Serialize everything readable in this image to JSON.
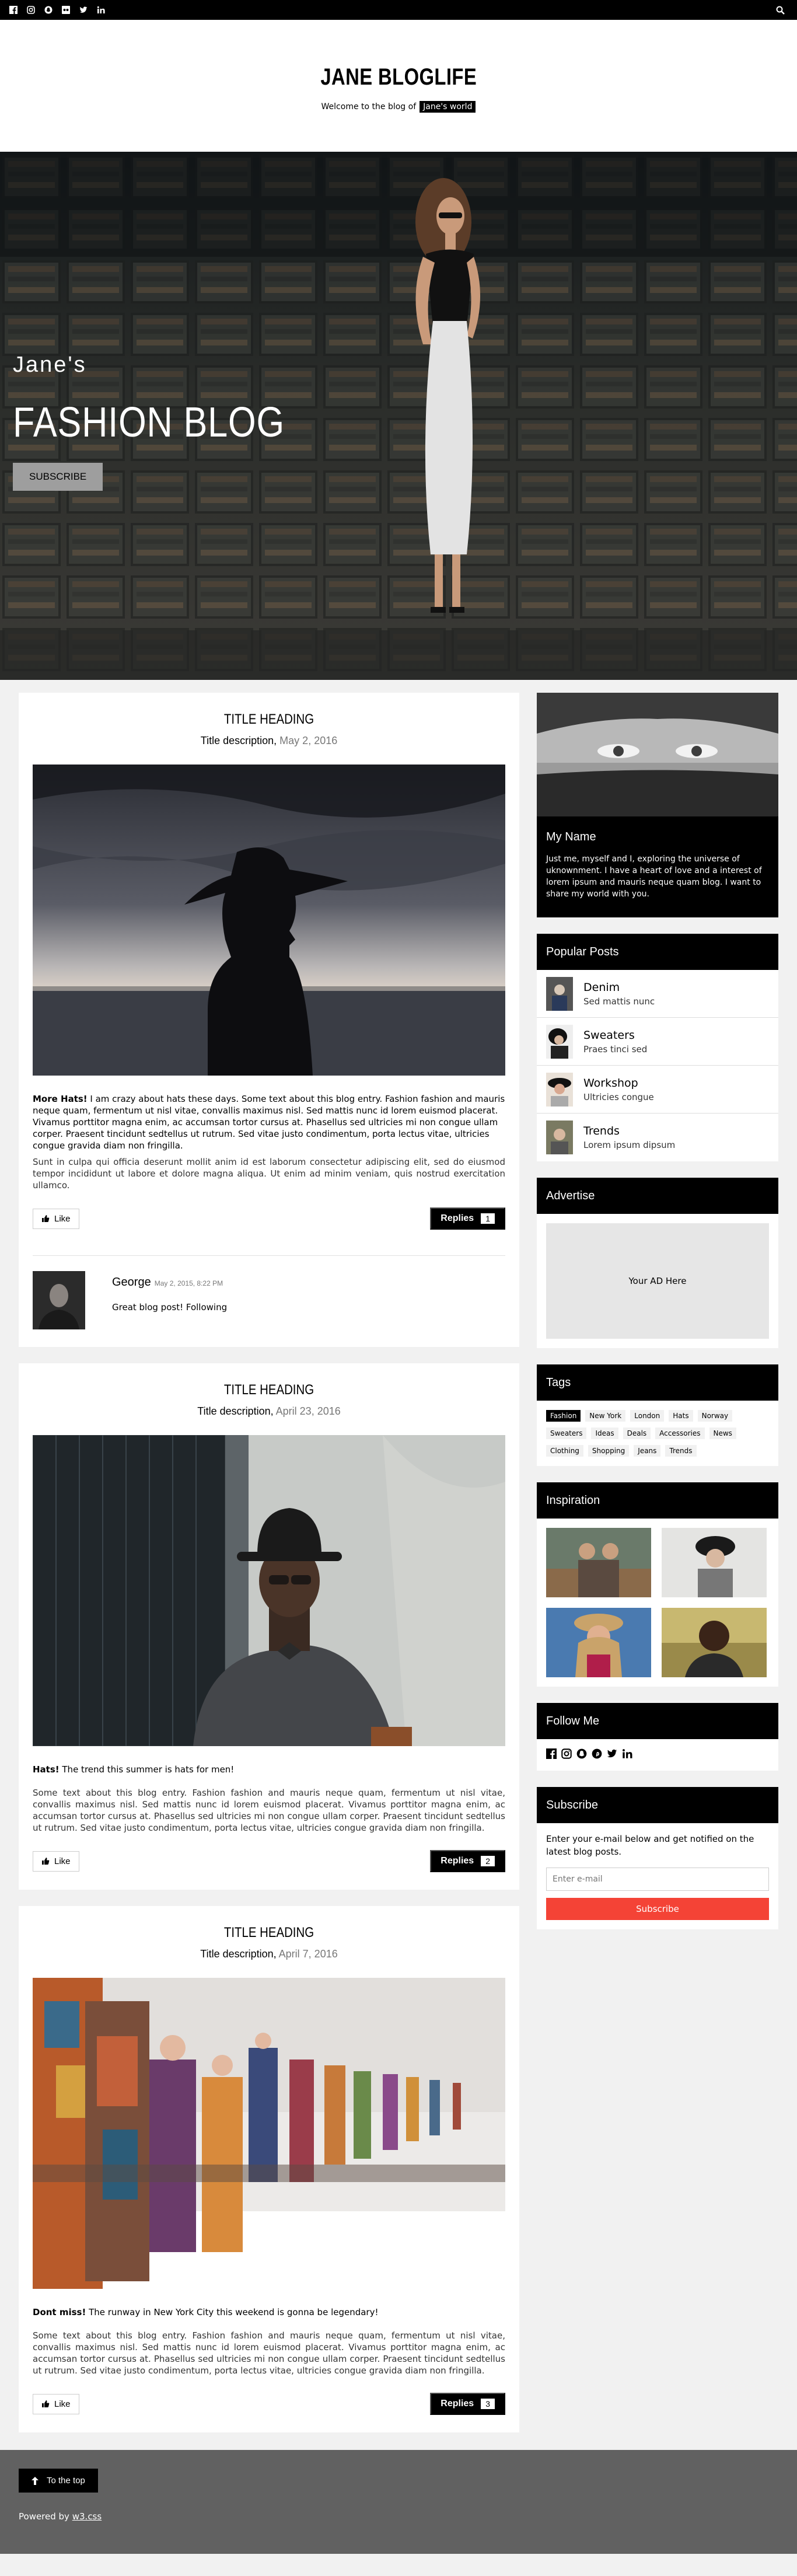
{
  "topbar": {
    "icons": [
      "facebook-icon",
      "instagram-icon",
      "snapchat-icon",
      "flickr-icon",
      "twitter-icon",
      "linkedin-icon"
    ],
    "search_icon": "search-icon"
  },
  "header": {
    "title": "JANE BLOGLIFE",
    "tagline": "Welcome to the blog of",
    "tagline_tag": "Jane's world"
  },
  "hero": {
    "small": "Jane's",
    "big": "FASHION BLOG",
    "button": "SUBSCRIBE"
  },
  "posts": [
    {
      "title": "TITLE HEADING",
      "subtitle": "Title description,",
      "date": "May 2, 2016",
      "lead_bold": "More Hats!",
      "lead": " I am crazy about hats these days. Some text about this blog entry. Fashion fashion and mauris neque quam, fermentum ut nisl vitae, convallis maximus nisl. Sed mattis nunc id lorem euismod placerat. Vivamus porttitor magna enim, ac accumsan tortor cursus at. Phasellus sed ultricies mi non congue ullam corper. Praesent tincidunt sedtellus ut rutrum. Sed vitae justo condimentum, porta lectus vitae, ultricies congue gravida diam non fringilla.",
      "body": "Sunt in culpa qui officia deserunt mollit anim id est laborum consectetur adipiscing elit, sed do eiusmod tempor incididunt ut labore et dolore magna aliqua. Ut enim ad minim veniam, quis nostrud exercitation ullamco.",
      "like": "Like",
      "replies": "Replies",
      "reply_count": "1",
      "comment": {
        "name": "George",
        "date": "May 2, 2015, 8:22 PM",
        "text": "Great blog post! Following"
      }
    },
    {
      "title": "TITLE HEADING",
      "subtitle": "Title description,",
      "date": "April 23, 2016",
      "lead_bold": "Hats!",
      "lead": " The trend this summer is hats for men!",
      "body": "Some text about this blog entry. Fashion fashion and mauris neque quam, fermentum ut nisl vitae, convallis maximus nisl. Sed mattis nunc id lorem euismod placerat. Vivamus porttitor magna enim, ac accumsan tortor cursus at. Phasellus sed ultricies mi non congue ullam corper. Praesent tincidunt sedtellus ut rutrum. Sed vitae justo condimentum, porta lectus vitae, ultricies congue gravida diam non fringilla.",
      "like": "Like",
      "replies": "Replies",
      "reply_count": "2"
    },
    {
      "title": "TITLE HEADING",
      "subtitle": "Title description,",
      "date": "April 7, 2016",
      "lead_bold": "Dont miss!",
      "lead": " The runway in New York City this weekend is gonna be legendary!",
      "body": "Some text about this blog entry. Fashion fashion and mauris neque quam, fermentum ut nisl vitae, convallis maximus nisl. Sed mattis nunc id lorem euismod placerat. Vivamus porttitor magna enim, ac accumsan tortor cursus at. Phasellus sed ultricies mi non congue ullam corper. Praesent tincidunt sedtellus ut rutrum. Sed vitae justo condimentum, porta lectus vitae, ultricies congue gravida diam non fringilla.",
      "like": "Like",
      "replies": "Replies",
      "reply_count": "3"
    }
  ],
  "sidebar": {
    "profile": {
      "name": "My Name",
      "text": "Just me, myself and I, exploring the universe of uknownment. I have a heart of love and a interest of lorem ipsum and mauris neque quam blog. I want to share my world with you."
    },
    "popular": {
      "title": "Popular Posts",
      "items": [
        {
          "title": "Denim",
          "sub": "Sed mattis nunc"
        },
        {
          "title": "Sweaters",
          "sub": "Praes tinci sed"
        },
        {
          "title": "Workshop",
          "sub": "Ultricies congue"
        },
        {
          "title": "Trends",
          "sub": "Lorem ipsum dipsum"
        }
      ]
    },
    "advertise": {
      "title": "Advertise",
      "ad": "Your AD Here"
    },
    "tags": {
      "title": "Tags",
      "items": [
        "Fashion",
        "New York",
        "London",
        "Hats",
        "Norway",
        "Sweaters",
        "Ideas",
        "Deals",
        "Accessories",
        "News",
        "Clothing",
        "Shopping",
        "Jeans",
        "Trends"
      ]
    },
    "inspiration": {
      "title": "Inspiration"
    },
    "follow": {
      "title": "Follow Me",
      "icons": [
        "facebook-icon",
        "instagram-icon",
        "snapchat-icon",
        "pinterest-icon",
        "twitter-icon",
        "linkedin-icon"
      ]
    },
    "subscribe": {
      "title": "Subscribe",
      "text": "Enter your e-mail below and get notified on the latest blog posts.",
      "placeholder": "Enter e-mail",
      "button": "Subscribe"
    }
  },
  "footer": {
    "to_top": "To the top",
    "powered": "Powered by",
    "powered_link": "w3.css"
  }
}
